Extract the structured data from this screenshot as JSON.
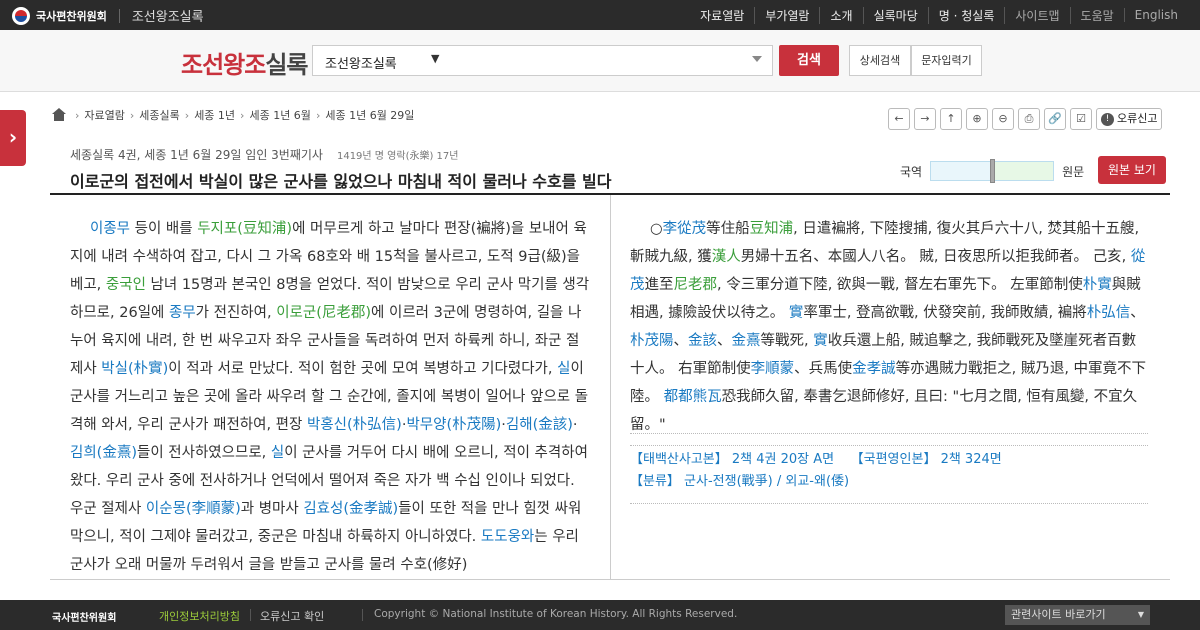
{
  "topbar": {
    "org": "국사편찬위원회",
    "site": "조선왕조실록",
    "nav": [
      "자료열람",
      "부가열람",
      "소개",
      "실록마당",
      "명 · 청실록",
      "사이트맵",
      "도움말",
      "English"
    ]
  },
  "header": {
    "brand_a": "조선왕조",
    "brand_b": "실록",
    "search_select": "조선왕조실록",
    "search_mark": "▼",
    "search_button": "검색",
    "advanced_button": "상세검색",
    "char_input_button": "문자입력기"
  },
  "sidetab_glyph": "›",
  "breadcrumb": [
    "자료열람",
    "세종실록",
    "세종 1년",
    "세종 1년 6월",
    "세종 1년 6월 29일"
  ],
  "tools": {
    "icons": [
      "arrow-left-icon",
      "arrow-right-icon",
      "arrow-up-icon",
      "zoom-in-icon",
      "zoom-out-icon",
      "print-icon",
      "link-icon",
      "checkbox-icon"
    ],
    "glyphs": [
      "←",
      "→",
      "↑",
      "⊕",
      "⊖",
      "⎙",
      "🔗",
      "☑"
    ],
    "report_label": "오류신고",
    "report_mark": "!"
  },
  "article": {
    "meta": "세종실록 4권, 세종 1년 6월 29일 임인 3번째기사",
    "year": "1419년 명 영락(永樂) 17년",
    "title": "이로군의 접전에서 박실이 많은 군사를 잃었으나 마침내 적이 물러나 수호를 빌다",
    "slider_left": "국역",
    "slider_right": "원문",
    "orig_button": "원본 보기"
  },
  "left_text": [
    {
      "t": "이종무",
      "c": "name"
    },
    {
      "t": " 등이 배를 "
    },
    {
      "t": "두지포(豆知浦)",
      "c": "place"
    },
    {
      "t": "에 머무르게 하고 날마다 편장(褊將)을 보내어 육지에 내려 수색하여 잡고, 다시 그 가옥 68호와 배 15척을 불사르고, 도적 9급(級)을 베고, "
    },
    {
      "t": "중국인",
      "c": "place"
    },
    {
      "t": " 남녀 15명과 본국인 8명을 얻었다. 적이 밤낮으로 우리 군사 막기를 생각하므로, 26일에 "
    },
    {
      "t": "종무",
      "c": "name"
    },
    {
      "t": "가 전진하여, "
    },
    {
      "t": "이로군(尼老郡)",
      "c": "place"
    },
    {
      "t": "에 이르러 3군에 명령하여, 길을 나누어 육지에 내려, 한 번 싸우고자 좌우 군사들을 독려하여 먼저 하륙케 하니, 좌군 절제사 "
    },
    {
      "t": "박실(朴實)",
      "c": "name"
    },
    {
      "t": "이 적과 서로 만났다. 적이 험한 곳에 모여 복병하고 기다렸다가, "
    },
    {
      "t": "실",
      "c": "name"
    },
    {
      "t": "이 군사를 거느리고 높은 곳에 올라 싸우려 할 그 순간에, 졸지에 복병이 일어나 앞으로 돌격해 와서, 우리 군사가 패전하여, 편장 "
    },
    {
      "t": "박홍신(朴弘信)",
      "c": "name"
    },
    {
      "t": "·"
    },
    {
      "t": "박무양(朴茂陽)",
      "c": "name"
    },
    {
      "t": "·"
    },
    {
      "t": "김해(金該)",
      "c": "name"
    },
    {
      "t": "·"
    },
    {
      "t": "김희(金熹)",
      "c": "name"
    },
    {
      "t": "들이 전사하였으므로, "
    },
    {
      "t": "실",
      "c": "name"
    },
    {
      "t": "이 군사를 거두어 다시 배에 오르니, 적이 추격하여 왔다. 우리 군사 중에 전사하거나 언덕에서 떨어져 죽은 자가 백 수십 인이나 되었다. 우군 절제사 "
    },
    {
      "t": "이순몽(李順蒙)",
      "c": "name"
    },
    {
      "t": "과 병마사 "
    },
    {
      "t": "김효성(金孝誠)",
      "c": "name"
    },
    {
      "t": "들이 또한 적을 만나 힘껏 싸워 막으니, 적이 그제야 물러갔고, 중군은 마침내 하륙하지 아니하였다. "
    },
    {
      "t": "도도웅와",
      "c": "name"
    },
    {
      "t": "는 우리 군사가 오래 머물까 두려워서 글을 받들고 군사를 물려 수호(修好)"
    }
  ],
  "right_text": [
    {
      "t": "○"
    },
    {
      "t": "李從茂",
      "c": "name"
    },
    {
      "t": "等住船"
    },
    {
      "t": "豆知浦",
      "c": "place"
    },
    {
      "t": ", 日遣褊將, 下陸搜捕, 復火其戶六十八, 焚其船十五艘, 斬賊九級, 獲"
    },
    {
      "t": "漢人",
      "c": "place"
    },
    {
      "t": "男婦十五名、本國人八名。 賊, 日夜思所以拒我師者。 己亥, "
    },
    {
      "t": "從茂",
      "c": "name"
    },
    {
      "t": "進至"
    },
    {
      "t": "尼老郡",
      "c": "place"
    },
    {
      "t": ", 令三軍分道下陸, 欲與一戰, 督左右軍先下。 左軍節制使"
    },
    {
      "t": "朴實",
      "c": "name"
    },
    {
      "t": "與賊相遇, 據險設伏以待之。 "
    },
    {
      "t": "實",
      "c": "name"
    },
    {
      "t": "率軍士, 登高欲戰, 伏發突前, 我師敗績, 褊將"
    },
    {
      "t": "朴弘信",
      "c": "name"
    },
    {
      "t": "、"
    },
    {
      "t": "朴茂陽",
      "c": "name"
    },
    {
      "t": "、"
    },
    {
      "t": "金該",
      "c": "name"
    },
    {
      "t": "、"
    },
    {
      "t": "金熹",
      "c": "name"
    },
    {
      "t": "等戰死, "
    },
    {
      "t": "實",
      "c": "name"
    },
    {
      "t": "收兵還上船, 賊追擊之, 我師戰死及墜崖死者百數十人。 右軍節制使"
    },
    {
      "t": "李順蒙",
      "c": "name"
    },
    {
      "t": "、兵馬使"
    },
    {
      "t": "金孝誠",
      "c": "name"
    },
    {
      "t": "等亦遇賊力戰拒之, 賊乃退, 中軍竟不下陸。 "
    },
    {
      "t": "都都熊瓦",
      "c": "name"
    },
    {
      "t": "恐我師久留, 奉書乞退師修好, 且曰: \"七月之間, 恒有風變, 不宜久留。\""
    }
  ],
  "refs": {
    "line1_a": "【태백산사고본】 2책 4권 20장 A면",
    "line1_b": "【국편영인본】 2책 324면",
    "line2": "【분류】 군사-전쟁(戰爭) / 외교-왜(倭)"
  },
  "footer": {
    "org": "국사편찬위원회",
    "privacy": "개인정보처리방침",
    "error_check": "오류신고 확인",
    "copyright": "Copyright © National Institute of Korean History. All Rights Reserved.",
    "related_sites": "관련사이트 바로가기"
  },
  "colors": {
    "accent": "#c8313c",
    "name": "#1a7ac2",
    "place": "#3a9e3a",
    "dark_bar": "#2b2b2b"
  }
}
